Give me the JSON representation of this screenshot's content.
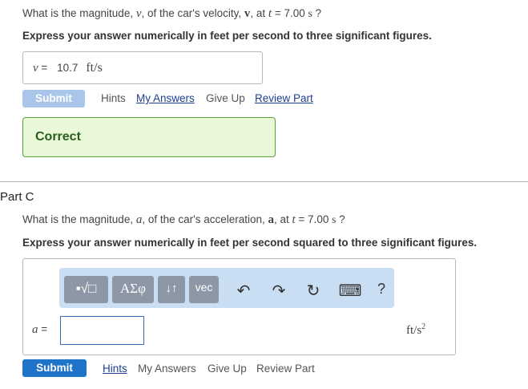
{
  "partB": {
    "q_prefix": "What is the magnitude, ",
    "q_var": "v",
    "q_mid": ", of the car's velocity, ",
    "q_vec": "v",
    "q_at": ", at ",
    "q_t": "t",
    "q_eq": " = 7.00 ",
    "q_unit": "s",
    "q_end": " ?",
    "instruction": "Express your answer numerically in feet per second to three significant figures.",
    "answer_label": "v",
    "answer_eq": " = ",
    "answer_value": "10.7",
    "answer_unit": "ft/s",
    "submit_label": "Submit",
    "hints": "Hints",
    "my_answers": "My Answers",
    "give_up": "Give Up",
    "review_part": "Review Part",
    "feedback": "Correct"
  },
  "partC": {
    "title": "Part C",
    "q_prefix": "What is the magnitude, ",
    "q_var": "a",
    "q_mid": ", of the car's acceleration, ",
    "q_vec": "a",
    "q_at": ", at ",
    "q_t": "t",
    "q_eq": " = 7.00 ",
    "q_unit": "s",
    "q_end": " ?",
    "instruction": "Express your answer numerically in feet per second squared to three significant figures.",
    "toolbar": {
      "templates_label": "▪√□",
      "greek_label": "ΑΣφ",
      "updown_label": "↓↑",
      "vec_label": "vec",
      "undo_icon": "↶",
      "redo_icon": "↷",
      "reset_icon": "↻",
      "keyboard_icon": "⌨",
      "help_icon": "?"
    },
    "answer_label": "a",
    "answer_eq": " =",
    "answer_value": "",
    "unit_base": "ft/s",
    "unit_exp": "2",
    "submit_label": "Submit",
    "hints": "Hints",
    "my_answers": "My Answers",
    "give_up": "Give Up",
    "review_part": "Review Part"
  },
  "colors": {
    "primary": "#1f73c8",
    "disabled": "#a9c6ea",
    "correct_bg": "#e9f8d9",
    "correct_border": "#5aa337",
    "toolbar_bg": "#c9def3"
  }
}
